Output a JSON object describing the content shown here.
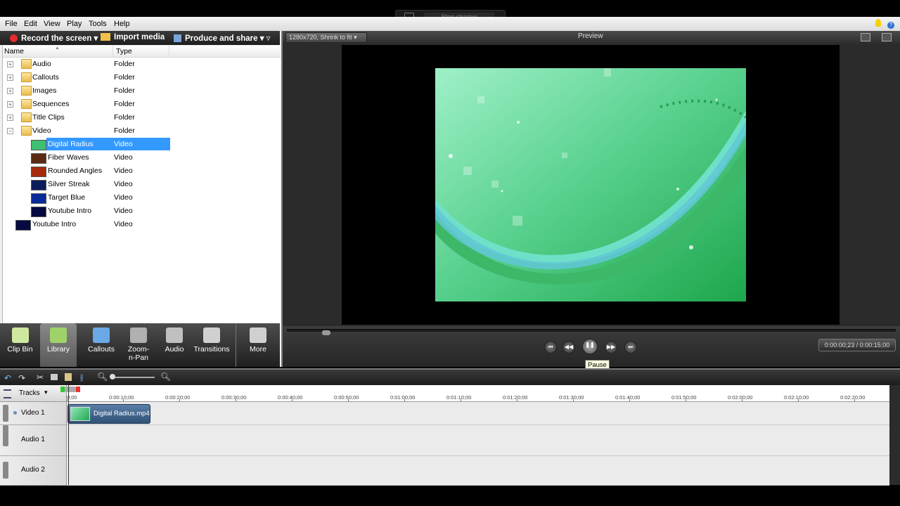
{
  "share": {
    "stop_label": "Stop sharing"
  },
  "menu": [
    "File",
    "Edit",
    "View",
    "Play",
    "Tools",
    "Help"
  ],
  "toolbar": {
    "record": "Record the screen",
    "import": "Import media",
    "produce": "Produce and share"
  },
  "library": {
    "col_name": "Name",
    "col_type": "Type",
    "rows": [
      {
        "name": "Audio",
        "type": "Folder",
        "kind": "folder",
        "expander": "+",
        "indent": 0
      },
      {
        "name": "Callouts",
        "type": "Folder",
        "kind": "folder",
        "expander": "+",
        "indent": 0
      },
      {
        "name": "Images",
        "type": "Folder",
        "kind": "folder",
        "expander": "+",
        "indent": 0
      },
      {
        "name": "Sequences",
        "type": "Folder",
        "kind": "folder",
        "expander": "+",
        "indent": 0
      },
      {
        "name": "Title Clips",
        "type": "Folder",
        "kind": "folder",
        "expander": "+",
        "indent": 0
      },
      {
        "name": "Video",
        "type": "Folder",
        "kind": "folder",
        "expander": "−",
        "indent": 0
      },
      {
        "name": "Digital Radius",
        "type": "Video",
        "kind": "thumb",
        "color": "#3fbf6f",
        "indent": 1,
        "selected": true
      },
      {
        "name": "Fiber Waves",
        "type": "Video",
        "kind": "thumb",
        "color": "#5a2a12",
        "indent": 1
      },
      {
        "name": "Rounded Angles",
        "type": "Video",
        "kind": "thumb",
        "color": "#a52a0d",
        "indent": 1
      },
      {
        "name": "Silver Streak",
        "type": "Video",
        "kind": "thumb",
        "color": "#0c1c5a",
        "indent": 1
      },
      {
        "name": "Target Blue",
        "type": "Video",
        "kind": "thumb",
        "color": "#0a2a9a",
        "indent": 1
      },
      {
        "name": "Youtube Intro",
        "type": "Video",
        "kind": "thumb",
        "color": "#050a40",
        "indent": 1
      },
      {
        "name": "Youtube Intro",
        "type": "Video",
        "kind": "thumb",
        "color": "#050a40",
        "indent": 2
      }
    ]
  },
  "tabs": [
    {
      "label": "Clip Bin",
      "icon": "clip-bin-icon",
      "color": "#cfe8a0"
    },
    {
      "label": "Library",
      "icon": "library-icon",
      "color": "#9fd36a",
      "active": true
    },
    {
      "label": "Callouts",
      "icon": "callouts-icon",
      "color": "#6aa9e6"
    },
    {
      "label": "Zoom-n-Pan",
      "icon": "zoom-n-pan-icon",
      "color": "#b0b0b0"
    },
    {
      "label": "Audio",
      "icon": "audio-icon",
      "color": "#c0c0c0"
    },
    {
      "label": "Transitions",
      "icon": "transitions-icon",
      "color": "#d0d0d0"
    },
    {
      "label": "More",
      "icon": "more-icon",
      "color": "#d0d0d0"
    }
  ],
  "preview": {
    "title": "Preview",
    "zoom": "1280x720, Shrink to fit",
    "tooltip": "Pause",
    "time": "0:00:00;23 / 0:00:15;00",
    "progress": 0.0
  },
  "timeline": {
    "tracks_label": "Tracks",
    "ticks": [
      "0;00",
      "0:00:10;00",
      "0:00:20;00",
      "0:00:30;00",
      "0:00:40;00",
      "0:00:50;00",
      "0:01:00;00",
      "0:01:10;00",
      "0:01:20;00",
      "0:01:30;00",
      "0:01:40;00",
      "0:01:50;00",
      "0:02:00;00",
      "0:02:10;00",
      "0:02:20;00"
    ],
    "tracks": [
      "Video 1",
      "Audio 1",
      "Audio 2"
    ],
    "clip": "Digital Radius.mp4"
  }
}
